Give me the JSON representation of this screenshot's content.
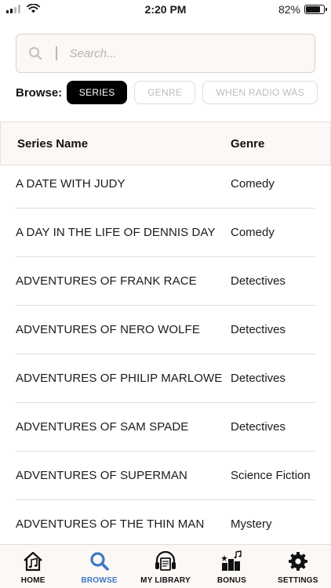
{
  "status_bar": {
    "time": "2:20 PM",
    "battery_text": "82%",
    "battery_level": 0.82,
    "icons": [
      "cellular-signal-icon",
      "wifi-icon",
      "battery-icon"
    ]
  },
  "search": {
    "placeholder": "Search...",
    "value": "",
    "icon": "search-icon"
  },
  "browse": {
    "label": "Browse:",
    "options": [
      "SERIES",
      "GENRE",
      "WHEN RADIO WAS"
    ],
    "selected": "SERIES"
  },
  "table": {
    "columns": [
      "Series Name",
      "Genre"
    ],
    "rows": [
      {
        "name": "A DATE WITH JUDY",
        "genre": "Comedy"
      },
      {
        "name": "A DAY IN THE LIFE OF DENNIS DAY",
        "genre": "Comedy"
      },
      {
        "name": "ADVENTURES OF FRANK RACE",
        "genre": "Detectives"
      },
      {
        "name": "ADVENTURES OF NERO WOLFE",
        "genre": "Detectives"
      },
      {
        "name": "ADVENTURES OF PHILIP MARLOWE",
        "genre": "Detectives"
      },
      {
        "name": "ADVENTURES OF SAM SPADE",
        "genre": "Detectives"
      },
      {
        "name": "ADVENTURES OF SUPERMAN",
        "genre": "Science Fiction"
      },
      {
        "name": "ADVENTURES OF THE THIN MAN",
        "genre": "Mystery"
      }
    ]
  },
  "tab_bar": {
    "tabs": [
      {
        "label": "HOME",
        "icon": "home-music-icon"
      },
      {
        "label": "BROWSE",
        "icon": "search-icon"
      },
      {
        "label": "MY LIBRARY",
        "icon": "headphones-book-icon"
      },
      {
        "label": "BONUS",
        "icon": "bonus-music-icon"
      },
      {
        "label": "SETTINGS",
        "icon": "gear-icon"
      }
    ],
    "active": "BROWSE"
  },
  "colors": {
    "accent": "#3c79c4",
    "panel_bg": "#fcf8f6",
    "selected_pill": "#000000"
  }
}
